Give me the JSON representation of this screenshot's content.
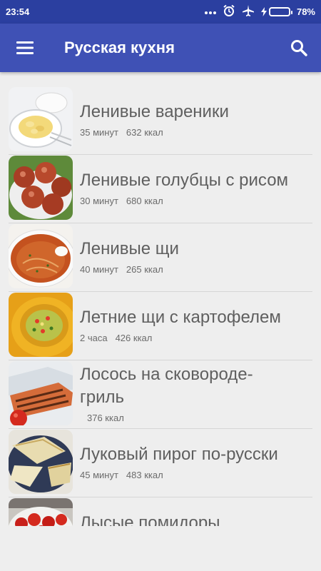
{
  "status_bar": {
    "time": "23:54",
    "battery_percent": "78%",
    "battery_level": 0.78,
    "icons": [
      "more-dots-icon",
      "alarm-icon",
      "airplane-mode-icon",
      "charging-bolt-icon",
      "battery-icon"
    ]
  },
  "app_bar": {
    "title": "Русская кухня",
    "menu_icon": "hamburger-menu-icon",
    "search_icon": "search-icon"
  },
  "recipes": [
    {
      "name": "Ленивые вареники",
      "time": "35 минут",
      "calories": "632 ккал",
      "image": "vareniki"
    },
    {
      "name": "Ленивые голубцы с рисом",
      "time": "30 минут",
      "calories": "680 ккал",
      "image": "golubtsy"
    },
    {
      "name": "Ленивые щи",
      "time": "40 минут",
      "calories": "265 ккал",
      "image": "shchi"
    },
    {
      "name": "Летние щи с картофелем",
      "time": "2 часа",
      "calories": "426 ккал",
      "image": "summer-shchi"
    },
    {
      "name_line1": "Лосось на сковороде-",
      "name_line2": "гриль",
      "time": "",
      "calories": "376 ккал",
      "image": "salmon"
    },
    {
      "name": "Луковый пирог по-русски",
      "time": "45 минут",
      "calories": "483 ккал",
      "image": "onion-pie"
    },
    {
      "name": "Лысые помидоры",
      "image": "tomatoes"
    }
  ],
  "colors": {
    "status_bar": "#2b3fa0",
    "app_bar": "#3f51b5",
    "background": "#eeeeee",
    "battery_fill": "#3ad33a"
  }
}
